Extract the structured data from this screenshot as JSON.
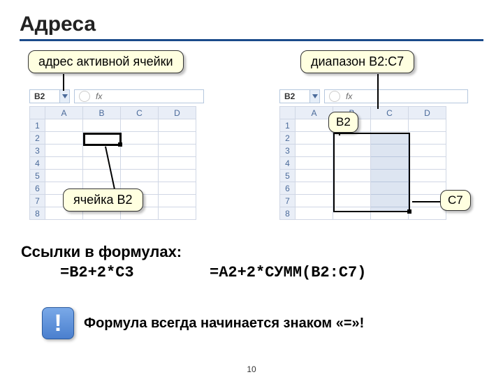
{
  "title": "Адреса",
  "callouts": {
    "active_cell": "адрес активной ячейки",
    "range": "диапазон B2:C7",
    "cell_b2": "ячейка B2",
    "lbl_b2": "B2",
    "lbl_c7": "C7"
  },
  "grid": {
    "namebox": "B2",
    "fx_label": "fx",
    "cols": [
      "A",
      "B",
      "C",
      "D"
    ],
    "rows": [
      "1",
      "2",
      "3",
      "4",
      "5",
      "6",
      "7",
      "8"
    ]
  },
  "refs_heading": "Ссылки в формулах:",
  "formula1": "=B2+2*C3",
  "formula2": "=A2+2*СУММ(B2:C7)",
  "note_bang": "!",
  "note_text": "Формула всегда начинается знаком «=»!",
  "page": "10"
}
